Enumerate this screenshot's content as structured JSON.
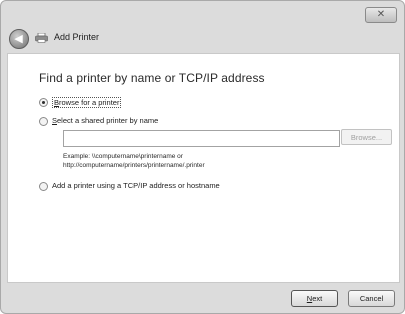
{
  "window": {
    "close_label": "✕",
    "back_icon": "back-arrow-icon",
    "title_icon": "printer-icon",
    "title": "Add Printer"
  },
  "main": {
    "heading": "Find a printer by name or TCP/IP address",
    "options": [
      {
        "label": "Browse for a printer",
        "checked": true
      },
      {
        "label": "Select a shared printer by name",
        "checked": false
      },
      {
        "label": "Add a printer using a TCP/IP address or hostname",
        "checked": false
      }
    ],
    "shared_printer_input": {
      "value": "",
      "placeholder": ""
    },
    "browse_label": "Browse...",
    "example_line1": "Example: \\\\computername\\printername or",
    "example_line2": "http://computername/printers/printername/.printer"
  },
  "footer": {
    "next_label": "Next",
    "cancel_label": "Cancel"
  }
}
